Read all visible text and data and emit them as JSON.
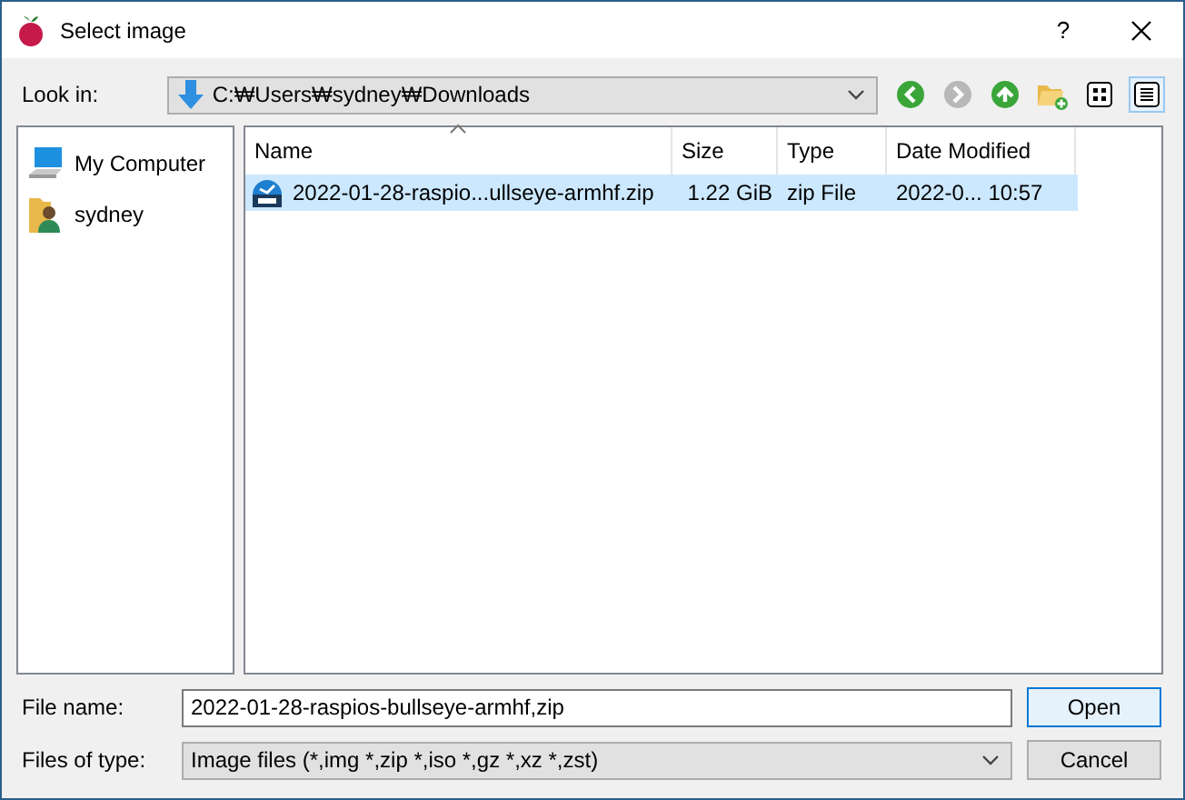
{
  "window": {
    "title": "Select image",
    "help": "?"
  },
  "look_in": {
    "label": "Look in:",
    "value": "C:₩Users₩sydney₩Downloads"
  },
  "toolbar": [
    {
      "kind": "back",
      "disabled": false
    },
    {
      "kind": "forward",
      "disabled": true
    },
    {
      "kind": "up",
      "disabled": false
    },
    {
      "kind": "newfolder"
    },
    {
      "kind": "icons",
      "selected": false
    },
    {
      "kind": "details",
      "selected": true
    }
  ],
  "sidebar": {
    "items": [
      {
        "kind": "computer",
        "label": "My Computer"
      },
      {
        "kind": "user",
        "label": "sydney"
      }
    ]
  },
  "table": {
    "columns": [
      "Name",
      "Size",
      "Type",
      "Date Modified"
    ],
    "rows": [
      {
        "name": "2022-01-28-raspio...ullseye-armhf.zip",
        "size": "1.22 GiB",
        "type": "zip File",
        "date": "2022-0... 10:57",
        "selected": true
      }
    ]
  },
  "file_name": {
    "label": "File name:",
    "value": "2022-01-28-raspios-bullseye-armhf,zip"
  },
  "file_type": {
    "label": "Files of type:",
    "value": "Image files (*,img *,zip *,iso *,gz *,xz *,zst)"
  },
  "buttons": [
    {
      "label": "Open",
      "default": true
    },
    {
      "label": "Cancel",
      "default": false
    }
  ]
}
